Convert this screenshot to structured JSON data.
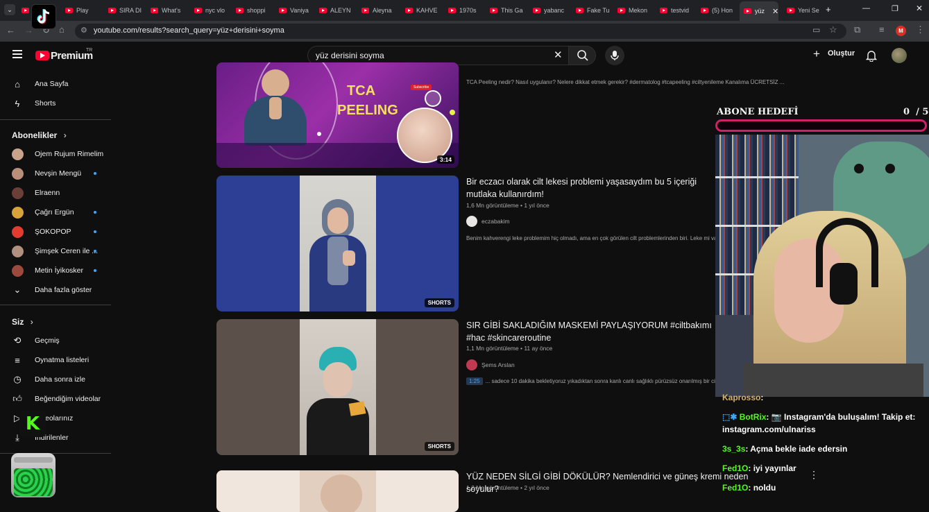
{
  "browser": {
    "tabs": [
      "",
      "Play",
      "SIRA DI",
      "What's",
      "nyc vlo",
      "shoppi",
      "Vaniya",
      "ALEYN",
      "Aleyna",
      "KAHVE",
      "1970s",
      "This Ga",
      "yabanc",
      "Fake Tu",
      "Mekon",
      "testvid",
      "(5) Hon",
      "yüz",
      "Yeni Se"
    ],
    "active_tab_index": 17,
    "new_tab": "+",
    "url": "youtube.com/results?search_query=yüz+derisini+soyma",
    "profile_initial": "M"
  },
  "header": {
    "logo_text": "Premium",
    "logo_region": "TR",
    "search_query": "yüz derisini soyma",
    "create_label": "Oluştur"
  },
  "sidebar": {
    "home": "Ana Sayfa",
    "shorts": "Shorts",
    "subscriptions_title": "Abonelikler",
    "channels": [
      {
        "name": "Ojem Rujum Rimelim",
        "dot": false,
        "color": "#c9a38a"
      },
      {
        "name": "Nevşin Mengü",
        "dot": true,
        "color": "#b98f7a"
      },
      {
        "name": "Elraenn",
        "dot": false,
        "color": "#6b3f35"
      },
      {
        "name": "Çağrı Ergün",
        "dot": true,
        "color": "#d7a33a"
      },
      {
        "name": "ŞOKOPOP",
        "dot": true,
        "color": "#e23c2f"
      },
      {
        "name": "Şimşek Ceren ile ...",
        "dot": true,
        "color": "#b0907f"
      },
      {
        "name": "Metin İyikosker",
        "dot": true,
        "color": "#9c4a3c"
      }
    ],
    "show_more": "Daha fazla göster",
    "you_title": "Siz",
    "you_items": [
      "Geçmiş",
      "Oynatma listeleri",
      "Daha sonra izle",
      "Beğendiğim videolar",
      "Videolarınız",
      "İndirilenler"
    ]
  },
  "results": [
    {
      "desc": "TCA Peeling nedir? Nasıl uygulanır? Nelere dikkat etmek gerekir? #dermatolog #tcapeeling #ciltyenileme Kanalıma ÜCRETSİZ ...",
      "duration": "3:14",
      "thumb_title_1": "TCA",
      "thumb_title_2": "PEELING",
      "thumb_sub": "Subscribe"
    },
    {
      "title": "Bir eczacı olarak cilt lekesi problemi yaşasaydım bu 5 içeriği mutlaka kullanırdım!",
      "views": "1,6 Mn görüntüleme",
      "age": "1 yıl önce",
      "channel": "eczabakim",
      "desc": "Benim kahverengi leke problemim hiç olmadı, ama en çok görülen cilt problemlerinden biri. Leke mi var?",
      "badge": "SHORTS"
    },
    {
      "title": "SIR GİBİ SAKLADIĞIM MASKEMİ PAYLAŞIYORUM #ciltbakımı #hac #skincareroutine",
      "views": "1,1 Mn görüntüleme",
      "age": "11 ay önce",
      "channel": "Şems Arslan",
      "chapter": "1:25",
      "desc": "... sadece 10 dakika bekletiyoruz yıkadıktan sonra kanlı canlı sağlıklı pürüzsüz onarılmış bir cilt",
      "badge": "SHORTS"
    },
    {
      "title": "YÜZ NEDEN SİLGİ GİBİ DÖKÜLÜR? Nemlendirici ve güneş kremi neden soyulur?",
      "views": "1,2 Mn görüntüleme",
      "age": "2 yıl önce"
    }
  ],
  "overlay": {
    "goal_title": "ABONE HEDEFİ",
    "goal_current": "0",
    "goal_target": "/ 5",
    "chat": [
      {
        "user": "Kaprosso",
        "text": "",
        "color": "#d6b56d"
      },
      {
        "user": "BotRix",
        "text": "📷 Instagram'da buluşalım! Takip et:",
        "color": "#53fc18"
      },
      {
        "user": "",
        "text": "instagram.com/ulnariss",
        "color": "#ffffff"
      },
      {
        "user": "3s_3s",
        "text": "Açma bekle iade edersin",
        "color": "#53fc18"
      },
      {
        "user": "Fed1O",
        "text": "iyi yayınlar",
        "color": "#53fc18"
      },
      {
        "user": "Fed1O",
        "text": "noldu",
        "color": "#53fc18"
      }
    ],
    "kick_letter": "K"
  }
}
